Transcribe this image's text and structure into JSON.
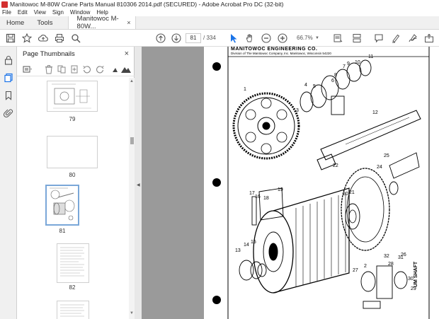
{
  "window": {
    "title": "Manitowoc M-80W Crane Parts Manual 810306 2014.pdf (SECURED) - Adobe Acrobat Pro DC (32-bit)"
  },
  "menu": [
    "File",
    "Edit",
    "View",
    "Sign",
    "Window",
    "Help"
  ],
  "tabs": {
    "home": "Home",
    "tools": "Tools",
    "document": "Manitowoc M-80W...",
    "close_symbol": "×"
  },
  "toolbar": {
    "current_page": "81",
    "total_pages": "/ 334",
    "zoom": "66.7%"
  },
  "thumbnail_panel": {
    "title": "Page Thumbnails",
    "close_symbol": "×",
    "pages": [
      {
        "label": "79",
        "selected": false
      },
      {
        "label": "80",
        "selected": false
      },
      {
        "label": "81",
        "selected": true
      },
      {
        "label": "82",
        "selected": false
      }
    ]
  },
  "document": {
    "header_company": "MANITOWOC ENGINEERING CO.",
    "header_division": "Division of The Manitowoc Company, Inc.     Manitowoc, Wisconsin 54220",
    "side_caption": "UM SHAFT",
    "part_numbers": [
      "1",
      "2",
      "3",
      "4",
      "5",
      "6",
      "7",
      "8",
      "9",
      "10",
      "11",
      "12",
      "13",
      "14",
      "15",
      "16",
      "17",
      "18",
      "19",
      "20",
      "21",
      "22",
      "24",
      "25",
      "26",
      "27",
      "28",
      "29",
      "30",
      "31",
      "32"
    ]
  },
  "colors": {
    "accent": "#1a73e8",
    "doc_background": "#9a9a9a",
    "selected_thumb_border": "#7aa7d8"
  }
}
